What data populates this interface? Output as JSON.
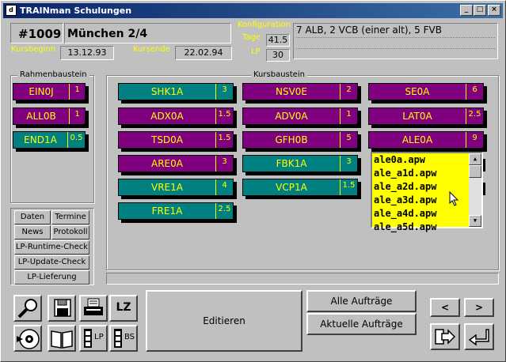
{
  "window": {
    "title": "TRAINman Schulungen",
    "icon_text": "d",
    "controls": [
      "_",
      "□",
      "×"
    ]
  },
  "header": {
    "course_id": "#1009",
    "course_name": "München 2/4",
    "kursbeginn_label": "Kursbeginn",
    "kursbeginn_value": "13.12.93",
    "kursende_label": "Kursende",
    "kursende_value": "22.02.94",
    "konfiguration_label": "Konfiguration",
    "konfiguration_value": "7 ALB, 2 VCB (einer alt), 5 FVB",
    "tage_label": "Tage",
    "tage_value": "41.5",
    "lp_label": "LP",
    "lp_value": "30"
  },
  "rahmenbaustein": {
    "title": "Rahmenbaustein",
    "items": [
      {
        "name": "EIN0J",
        "value": "1",
        "color": "#800080"
      },
      {
        "name": "ALL0B",
        "value": "1",
        "color": "#800080"
      },
      {
        "name": "END1A",
        "value": "0.5",
        "color": "#008080"
      }
    ]
  },
  "kursbaustein": {
    "title": "Kursbaustein",
    "col1": [
      {
        "name": "SHK1A",
        "value": "3",
        "color": "#008080"
      },
      {
        "name": "ADX0A",
        "value": "1.5",
        "color": "#800080"
      },
      {
        "name": "TSD0A",
        "value": "1.5",
        "color": "#800080"
      },
      {
        "name": "ARE0A",
        "value": "3",
        "color": "#800080"
      },
      {
        "name": "VRE1A",
        "value": "4",
        "color": "#008080"
      },
      {
        "name": "FRE1A",
        "value": "2.5",
        "color": "#008080"
      }
    ],
    "col2": [
      {
        "name": "NSV0E",
        "value": "2",
        "color": "#800080"
      },
      {
        "name": "ADV0A",
        "value": "1",
        "color": "#800080"
      },
      {
        "name": "GFH0B",
        "value": "5",
        "color": "#800080"
      },
      {
        "name": "FBK1A",
        "value": "3",
        "color": "#008080"
      },
      {
        "name": "VCP1A",
        "value": "1.5",
        "color": "#008080"
      }
    ],
    "col3": [
      {
        "name": "SE0A",
        "value": "6",
        "color": "#800080"
      },
      {
        "name": "LAT0A",
        "value": "2.5",
        "color": "#800080"
      },
      {
        "name": "ALE0A",
        "value": "9",
        "color": "#800080"
      }
    ]
  },
  "file_list": {
    "items": [
      "ale0a.apw",
      "ale_a1d.apw",
      "ale_a2d.apw",
      "ale_a3d.apw",
      "ale_a4d.apw",
      "ale_a5d.apw"
    ],
    "scroll_up": "▲",
    "scroll_down": "▼"
  },
  "nav_buttons": {
    "daten": "Daten",
    "termine": "Termine",
    "news": "News",
    "protokoll": "Protokoll",
    "runtime_check": "LP-Runtime-Check",
    "update_check": "LP-Update-Check",
    "lieferung": "LP-Lieferung"
  },
  "toolbar": {
    "lz_label": "LZ",
    "lp_label": "LP",
    "bs_label": "BS",
    "editieren": "Editieren",
    "alle_auftraege": "Alle Aufträge",
    "aktuelle_auftraege": "Aktuelle Aufträge",
    "prev": "<",
    "next": ">"
  }
}
